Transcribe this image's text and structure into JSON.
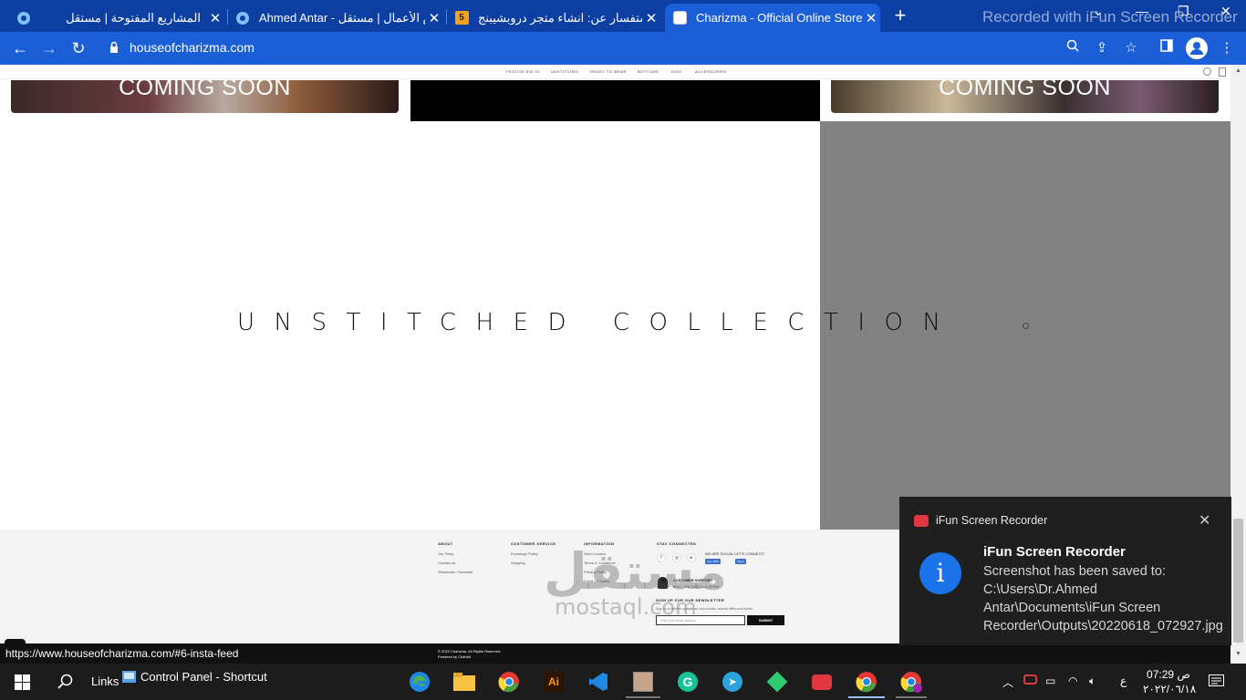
{
  "browser": {
    "tabs": [
      {
        "title": "المشاريع المفتوحة | مستقل",
        "icon": "mostaql-icon",
        "active": false
      },
      {
        "title": "Ahmed Antar - معرض الأعمال | مستقل",
        "icon": "mostaql-icon",
        "active": false
      },
      {
        "title": "استفسار عن: انشاء متجر دروبشيبنج",
        "icon": "five-icon",
        "active": false
      },
      {
        "title": "Charizma - Official Online Store",
        "icon": "charizma-icon",
        "active": true
      }
    ],
    "new_tab_label": "+",
    "recorder_watermark": "Recorded with iFun Screen Recorder",
    "url": "houseofcharizma.com",
    "status_url": "https://www.houseofcharizma.com/#6-insta-feed"
  },
  "site": {
    "nav_items": [
      "FESTIVE EID 22",
      "UNSTITCHED",
      "READY TO WEAR",
      "BOTTOMS",
      "KIDS",
      "ACCESSORIES"
    ],
    "tile_left_text": "COMING SOON",
    "tile_right_text": "COMING SOON",
    "hero_title": "UNSTITCHED COLLECTION",
    "footer": {
      "about": {
        "heading": "ABOUT",
        "links": [
          "Our Story",
          "Contact us",
          "Wholesale / Stockists"
        ]
      },
      "customer_service": {
        "heading": "CUSTOMER SERVICE",
        "links": [
          "Exchange Policy",
          "Shipping"
        ]
      },
      "information": {
        "heading": "INFORMATION",
        "links": [
          "Store Locator",
          "Terms & Conditions",
          "Privacy Policy",
          "Covid-19 Safety"
        ]
      },
      "stay_connected": {
        "heading": "STAY CONNECTED",
        "social_text": "WE ARE SOCIAL LET'S CONNECT!",
        "like_label": "Like 256K",
        "share_label": "Share"
      },
      "support": {
        "heading": "CUSTOMER SUPPORT",
        "hours": "Mon – Sat 10:00 to 5:30 PM"
      },
      "newsletter": {
        "heading": "SIGN UP FOR OUR NEWSLETTER",
        "text": "Sign up to receive updates on new arrivals, special offers and trends",
        "placeholder": "enter your email address",
        "submit": "SUBMIT"
      },
      "copyright": "© 2022 Charizma. All Rights Reserved.",
      "powered": "Powered by Clothbit."
    }
  },
  "watermark": {
    "arabic": "مستقل",
    "latin": "mostaql.com"
  },
  "toast": {
    "app": "iFun Screen Recorder",
    "title": "iFun Screen Recorder",
    "message": "Screenshot has been saved to: C:\\Users\\Dr.Ahmed Antar\\Documents\\iFun Screen Recorder\\Outputs\\20220618_072927.jpg"
  },
  "taskbar": {
    "links_label": "Links",
    "control_panel_label": "Control Panel - Shortcut",
    "time": "07:29 ص",
    "date": "٢٠٢٢/٠٦/١٨",
    "lang": "ع"
  }
}
